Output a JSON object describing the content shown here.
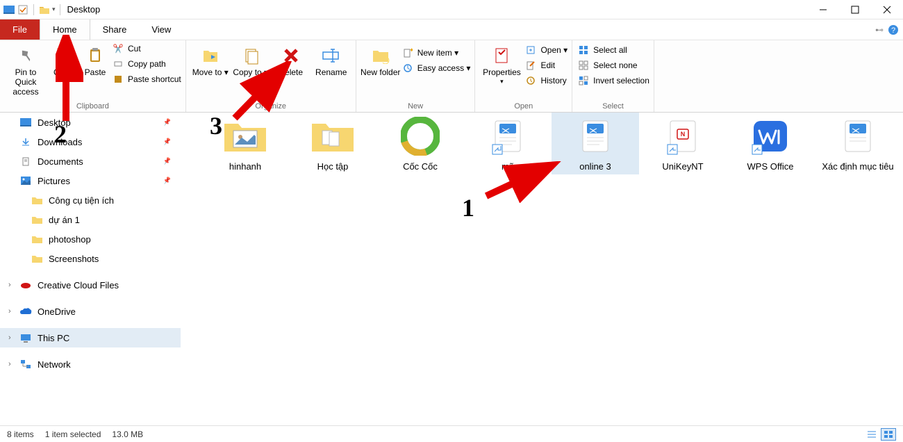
{
  "window": {
    "title": "Desktop"
  },
  "tabs": {
    "file": "File",
    "home": "Home",
    "share": "Share",
    "view": "View"
  },
  "ribbon": {
    "clipboard": {
      "title": "Clipboard",
      "pin": "Pin to Quick access",
      "copy": "Copy",
      "paste": "Paste",
      "cut": "Cut",
      "copy_path": "Copy path",
      "paste_shortcut": "Paste shortcut"
    },
    "organize": {
      "title": "Organize",
      "move_to": "Move to ▾",
      "copy_to": "Copy to ▾",
      "delete": "Delete",
      "rename": "Rename"
    },
    "new": {
      "title": "New",
      "new_folder": "New folder",
      "new_item": "New item ▾",
      "easy_access": "Easy access ▾"
    },
    "open": {
      "title": "Open",
      "properties": "Properties",
      "open": "Open ▾",
      "edit": "Edit",
      "history": "History"
    },
    "select": {
      "title": "Select",
      "select_all": "Select all",
      "select_none": "Select none",
      "invert": "Invert selection"
    }
  },
  "nav": {
    "desktop": "Desktop",
    "downloads": "Downloads",
    "documents": "Documents",
    "pictures": "Pictures",
    "cong_cu": "Công cụ tiện ích",
    "du_an": "dự án 1",
    "photoshop": "photoshop",
    "screenshots": "Screenshots",
    "creative": "Creative Cloud Files",
    "onedrive": "OneDrive",
    "this_pc": "This PC",
    "network": "Network"
  },
  "files": [
    {
      "name": "hinhanh"
    },
    {
      "name": "Học tập"
    },
    {
      "name": "Cốc Cốc"
    },
    {
      "name": "mã"
    },
    {
      "name": "online 3"
    },
    {
      "name": "UniKeyNT"
    },
    {
      "name": "WPS Office"
    },
    {
      "name": "Xác định mục tiêu"
    }
  ],
  "status": {
    "item_count": "8 items",
    "selected": "1 item selected",
    "size": "13.0 MB"
  },
  "annotations": {
    "a1": "1",
    "a2": "2",
    "a3": "3"
  }
}
